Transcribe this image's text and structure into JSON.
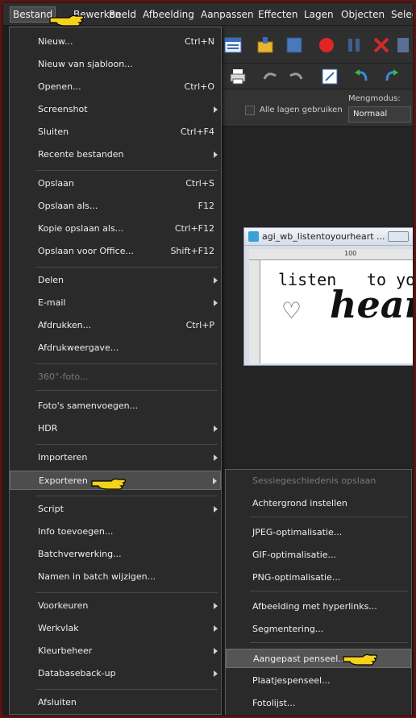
{
  "menubar": {
    "items": [
      "Bestand",
      "Bewerken",
      "Beeld",
      "Afbeelding",
      "Aanpassen",
      "Effecten",
      "Lagen",
      "Objecten",
      "Selec"
    ]
  },
  "options": {
    "checkbox_label": "Alle lagen gebruiken",
    "blend_label": "Mengmodus:",
    "blend_value": "Normaal"
  },
  "image_window": {
    "title": "agi_wb_listentoyourheart ...",
    "ruler_mark": "100",
    "text_top": "listen",
    "text_right": "to you",
    "text_script": "hear"
  },
  "menu": {
    "items": [
      {
        "label": "Nieuw...",
        "shortcut": "Ctrl+N"
      },
      {
        "label": "Nieuw van sjabloon...",
        "shortcut": ""
      },
      {
        "label": "Openen...",
        "shortcut": "Ctrl+O"
      },
      {
        "label": "Screenshot",
        "shortcut": ""
      },
      {
        "label": "Sluiten",
        "shortcut": "Ctrl+F4"
      },
      {
        "label": "Recente bestanden",
        "shortcut": ""
      },
      {
        "label": "Opslaan",
        "shortcut": "Ctrl+S"
      },
      {
        "label": "Opslaan als...",
        "shortcut": "F12"
      },
      {
        "label": "Kopie opslaan als...",
        "shortcut": "Ctrl+F12"
      },
      {
        "label": "Opslaan voor Office...",
        "shortcut": "Shift+F12"
      },
      {
        "label": "Delen",
        "shortcut": ""
      },
      {
        "label": "E-mail",
        "shortcut": ""
      },
      {
        "label": "Afdrukken...",
        "shortcut": "Ctrl+P"
      },
      {
        "label": "Afdrukweergave...",
        "shortcut": ""
      },
      {
        "label": "360°-foto...",
        "shortcut": ""
      },
      {
        "label": "Foto's samenvoegen...",
        "shortcut": ""
      },
      {
        "label": "HDR",
        "shortcut": ""
      },
      {
        "label": "Importeren",
        "shortcut": ""
      },
      {
        "label": "Exporteren",
        "shortcut": ""
      },
      {
        "label": "Script",
        "shortcut": ""
      },
      {
        "label": "Info toevoegen...",
        "shortcut": ""
      },
      {
        "label": "Batchverwerking...",
        "shortcut": ""
      },
      {
        "label": "Namen in batch wijzigen...",
        "shortcut": ""
      },
      {
        "label": "Voorkeuren",
        "shortcut": ""
      },
      {
        "label": "Werkvlak",
        "shortcut": ""
      },
      {
        "label": "Kleurbeheer",
        "shortcut": ""
      },
      {
        "label": "Databaseback-up",
        "shortcut": ""
      },
      {
        "label": "Afsluiten",
        "shortcut": ""
      }
    ]
  },
  "submenu": {
    "items": [
      {
        "label": "Sessiegeschiedenis opslaan"
      },
      {
        "label": "Achtergrond instellen"
      },
      {
        "label": "JPEG-optimalisatie..."
      },
      {
        "label": "GIF-optimalisatie..."
      },
      {
        "label": "PNG-optimalisatie..."
      },
      {
        "label": "Afbeelding met hyperlinks..."
      },
      {
        "label": "Segmentering..."
      },
      {
        "label": "Aangepast penseel..."
      },
      {
        "label": "Plaatjespenseel..."
      },
      {
        "label": "Fotolijst..."
      }
    ]
  }
}
